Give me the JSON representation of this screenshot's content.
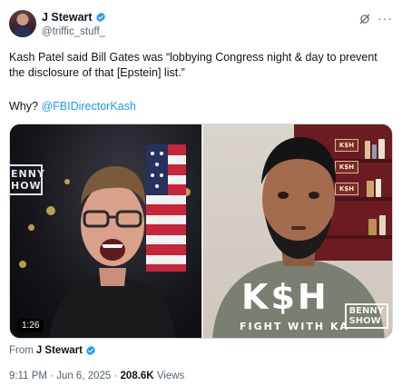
{
  "post": {
    "author": {
      "display_name": "J Stewart",
      "handle": "@triffic_stuff_",
      "verified": true
    },
    "text_line": "Kash Patel said Bill Gates was “lobbying Congress night & day to prevent the disclosure of that [Epstein] list.”",
    "why_prefix": "Why? ",
    "mention": "@FBIDirectorKash",
    "icons": {
      "avatar": "avatar",
      "verified": "verified-badge-icon",
      "grok": "grok-icon",
      "more": "more-icon"
    },
    "more_glyph": "···"
  },
  "media": {
    "duration": "1:26",
    "left_logo_text": "ENNY\nHOW",
    "shirt_logo": "K$H",
    "shirt_sub": "FIGHT WITH KA",
    "shelf_labels": [
      "K$H",
      "K$H",
      "K$H"
    ],
    "watermark": "BENNY\nSHOW"
  },
  "attribution": {
    "from_prefix": "From ",
    "from_name": "J Stewart"
  },
  "meta": {
    "timestamp": "9:11 PM · Jun 6, 2025 · ",
    "views_count": "208.6K",
    "views_label": " Views"
  },
  "colors": {
    "accent": "#1d9bf0",
    "text_primary": "#0f1419",
    "text_secondary": "#536471"
  }
}
